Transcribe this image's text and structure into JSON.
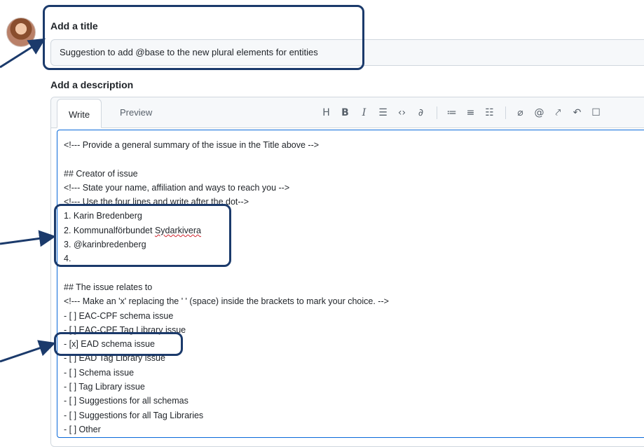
{
  "title_section": {
    "label": "Add a title",
    "value": "Suggestion to add @base to the new plural elements for entities"
  },
  "description_section": {
    "label": "Add a description",
    "tabs": [
      {
        "label": "Write",
        "active": true
      },
      {
        "label": "Preview",
        "active": false
      }
    ],
    "toolbar_icons": [
      "heading-icon",
      "bold-icon",
      "italic-icon",
      "quote-icon",
      "code-icon",
      "link-icon",
      "ordered-list-icon",
      "unordered-list-icon",
      "task-list-icon",
      "attach-icon",
      "mention-icon",
      "reference-icon",
      "undo-icon",
      "fullscreen-icon"
    ]
  },
  "body_lines": [
    "<!--- Provide a general summary of the issue in the Title above -->",
    "",
    "## Creator of issue",
    "<!--- State your name, affiliation and ways to reach you -->",
    "<!--- Use the four lines and write after the dot-->",
    "1. Karin Bredenberg",
    "2. Kommunalförbundet Sydarkivera",
    "3. @karinbredenberg",
    "4.",
    "",
    "## The issue relates to",
    "<!--- Make an 'x' replacing the ' ' (space) inside the brackets to mark your choice. -->",
    "- [ ] EAC-CPF schema issue",
    "- [ ] EAC-CPF Tag Library issue",
    "- [x] EAD schema issue",
    "- [ ] EAD Tag Library issue",
    "- [ ] Schema issue",
    "- [ ] Tag Library issue",
    "- [ ] Suggestions for all schemas",
    "- [ ] Suggestions for all Tag Libraries",
    "- [ ] Other"
  ],
  "annotation_color": "#1b3a6b",
  "accent_color": "#0969da"
}
